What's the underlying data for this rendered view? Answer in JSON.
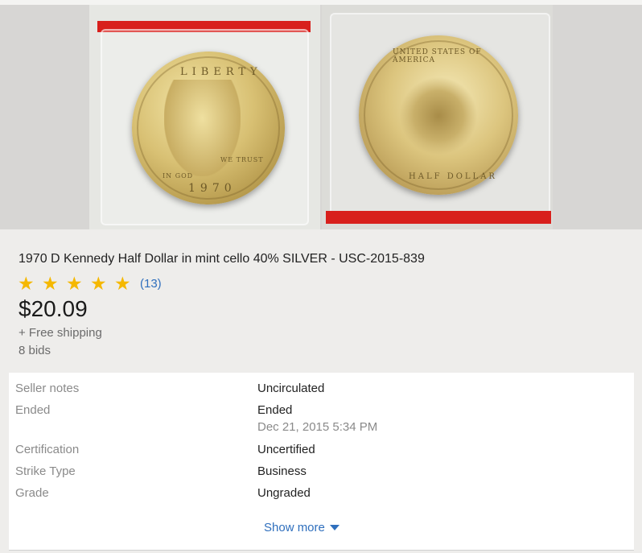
{
  "listing": {
    "title": "1970 D Kennedy Half Dollar in mint cello 40% SILVER - USC-2015-839",
    "rating": {
      "stars": 5,
      "review_count": "(13)"
    },
    "price": "$20.09",
    "shipping": "+ Free shipping",
    "bids": "8 bids"
  },
  "coin_images": {
    "obverse": {
      "legend_top": "LIBERTY",
      "motto": "IN GOD",
      "motto2": "WE TRUST",
      "year": "1970"
    },
    "reverse": {
      "legend_top": "UNITED STATES OF AMERICA",
      "legend_bottom": "HALF DOLLAR"
    }
  },
  "specs": {
    "rows": [
      {
        "label": "Seller notes",
        "value": "Uncirculated"
      },
      {
        "label": "Ended",
        "value": "Ended",
        "sub": "Dec 21, 2015 5:34 PM"
      },
      {
        "label": "Certification",
        "value": "Uncertified"
      },
      {
        "label": "Strike Type",
        "value": "Business"
      },
      {
        "label": "Grade",
        "value": "Ungraded"
      }
    ],
    "show_more_label": "Show more"
  },
  "colors": {
    "star": "#f5b800",
    "link": "#2f6fbd",
    "cello_band": "#d8201c"
  },
  "icons": {
    "star": "star-icon",
    "caret": "caret-down-icon"
  }
}
